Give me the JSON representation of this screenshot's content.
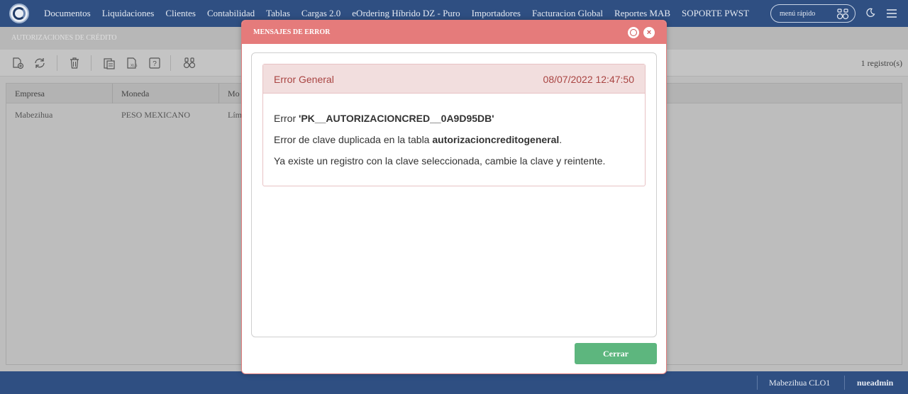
{
  "nav": {
    "items": [
      "Documentos",
      "Liquidaciones",
      "Clientes",
      "Contabilidad",
      "Tablas",
      "Cargas 2.0",
      "eOrdering Híbrido DZ - Puro",
      "Importadores",
      "Facturacion Global",
      "Reportes MAB",
      "SOPORTE PWST"
    ],
    "quick_menu": "menú rápido"
  },
  "page": {
    "title": "AUTORIZACIONES DE CRÉDITO",
    "record_count": "1 registro(s)",
    "columns": [
      "Empresa",
      "Moneda",
      "Mo"
    ],
    "row": [
      "Mabezihua",
      "PESO MEXICANO",
      "Lím"
    ]
  },
  "footer": {
    "company": "Mabezihua CLO1",
    "user": "nueadmin"
  },
  "modal": {
    "title": "MENSAJES DE ERROR",
    "error_title": "Error General",
    "error_date": "08/07/2022 12:47:50",
    "line1_prefix": "Error ",
    "line1_code": "'PK__AUTORIZACIONCRED__0A9D95DB'",
    "line2_prefix": "Error de clave duplicada en la tabla ",
    "line2_table": "autorizacioncreditogeneral",
    "line2_suffix": ".",
    "line3": "Ya existe un registro con la clave seleccionada, cambie la clave y reintente.",
    "close_label": "Cerrar"
  },
  "colors": {
    "nav_bg": "#2f4f82",
    "modal_header": "#e57b7b",
    "error_text": "#a94442",
    "error_bg": "#f2dede",
    "close_button": "#5db67e"
  }
}
